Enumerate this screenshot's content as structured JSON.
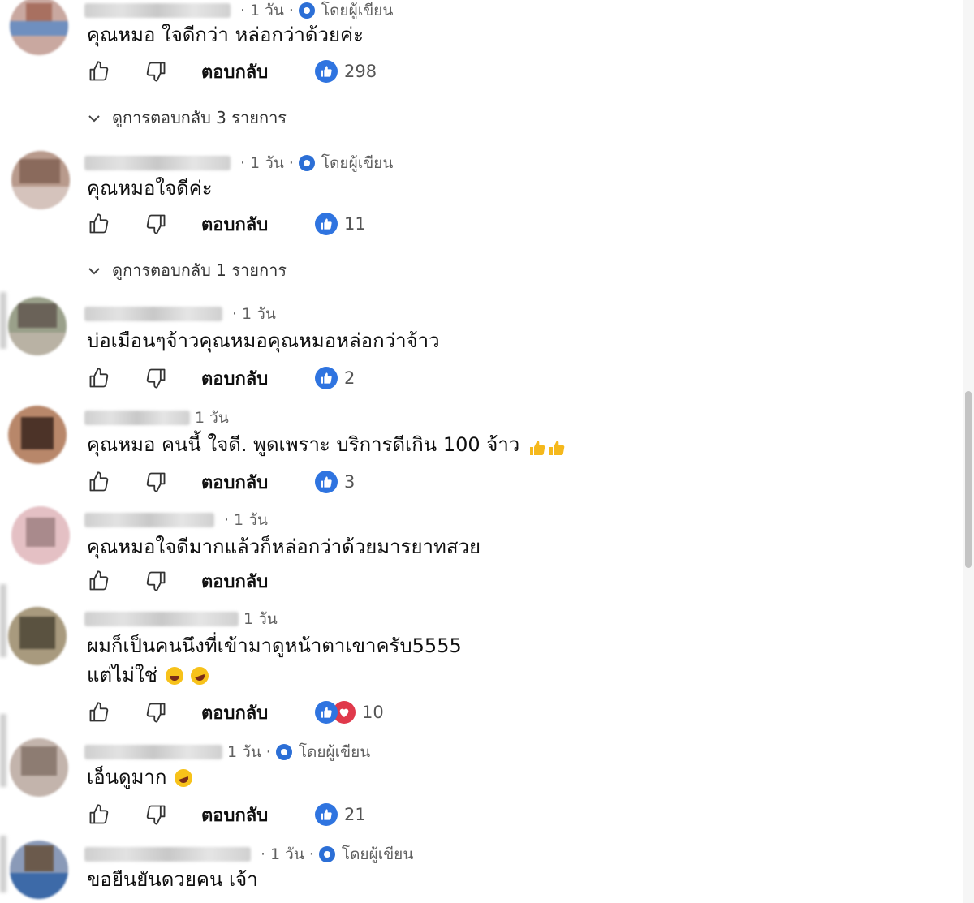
{
  "colors": {
    "accent": "#2f74e0",
    "heart": "#e0394b",
    "meta": "#606060"
  },
  "reply_label": "ตอบกลับ",
  "author_label": "โดยผู้เขียน",
  "comments": [
    {
      "time": "1 วัน",
      "author_badge": true,
      "text": "คุณหมอ ใจดีกว่า หล่อกว่าด้วยค่ะ",
      "reactions": [
        "like"
      ],
      "count": "298",
      "replies": "ดูการตอบกลับ 3 รายการ"
    },
    {
      "time": "1 วัน",
      "author_badge": true,
      "text": "คุณหมอใจดีค่ะ",
      "reactions": [
        "like"
      ],
      "count": "11",
      "replies": "ดูการตอบกลับ 1 รายการ"
    },
    {
      "time": "1 วัน",
      "author_badge": false,
      "text": "บ่อเมือนๆจ้าวคุณหมอคุณหมอหล่อกว่าจ้าว",
      "reactions": [
        "like"
      ],
      "count": "2"
    },
    {
      "time": "1 วัน",
      "author_badge": false,
      "text": "คุณหมอ คนนี้ ใจดี. พูดเพราะ บริการดีเกิน 100 จ้าว",
      "emoji": [
        "thumbs-up",
        "thumbs-up"
      ],
      "reactions": [
        "like"
      ],
      "count": "3"
    },
    {
      "time": "1 วัน",
      "author_badge": false,
      "text": "คุณหมอใจดีมากแล้วก็หล่อกว่าด้วยมารยาทสวย",
      "reactions": [],
      "count": ""
    },
    {
      "time": "1 วัน",
      "author_badge": false,
      "text": "ผมก็เป็นคนนึงที่เข้ามาดูหน้าตาเขาครับ5555",
      "text2": "แต่ไม่ใช่",
      "emoji": [
        "laughing",
        "rofl"
      ],
      "reactions": [
        "like",
        "heart"
      ],
      "count": "10"
    },
    {
      "time": "1 วัน",
      "author_badge": true,
      "text": "เอ็นดูมาก",
      "emoji": [
        "rofl"
      ],
      "reactions": [
        "like"
      ],
      "count": "21"
    },
    {
      "time": "1 วัน",
      "author_badge": true,
      "text": "ขอยืนยันดวยคน เจ้า",
      "reactions": [],
      "count": ""
    }
  ]
}
